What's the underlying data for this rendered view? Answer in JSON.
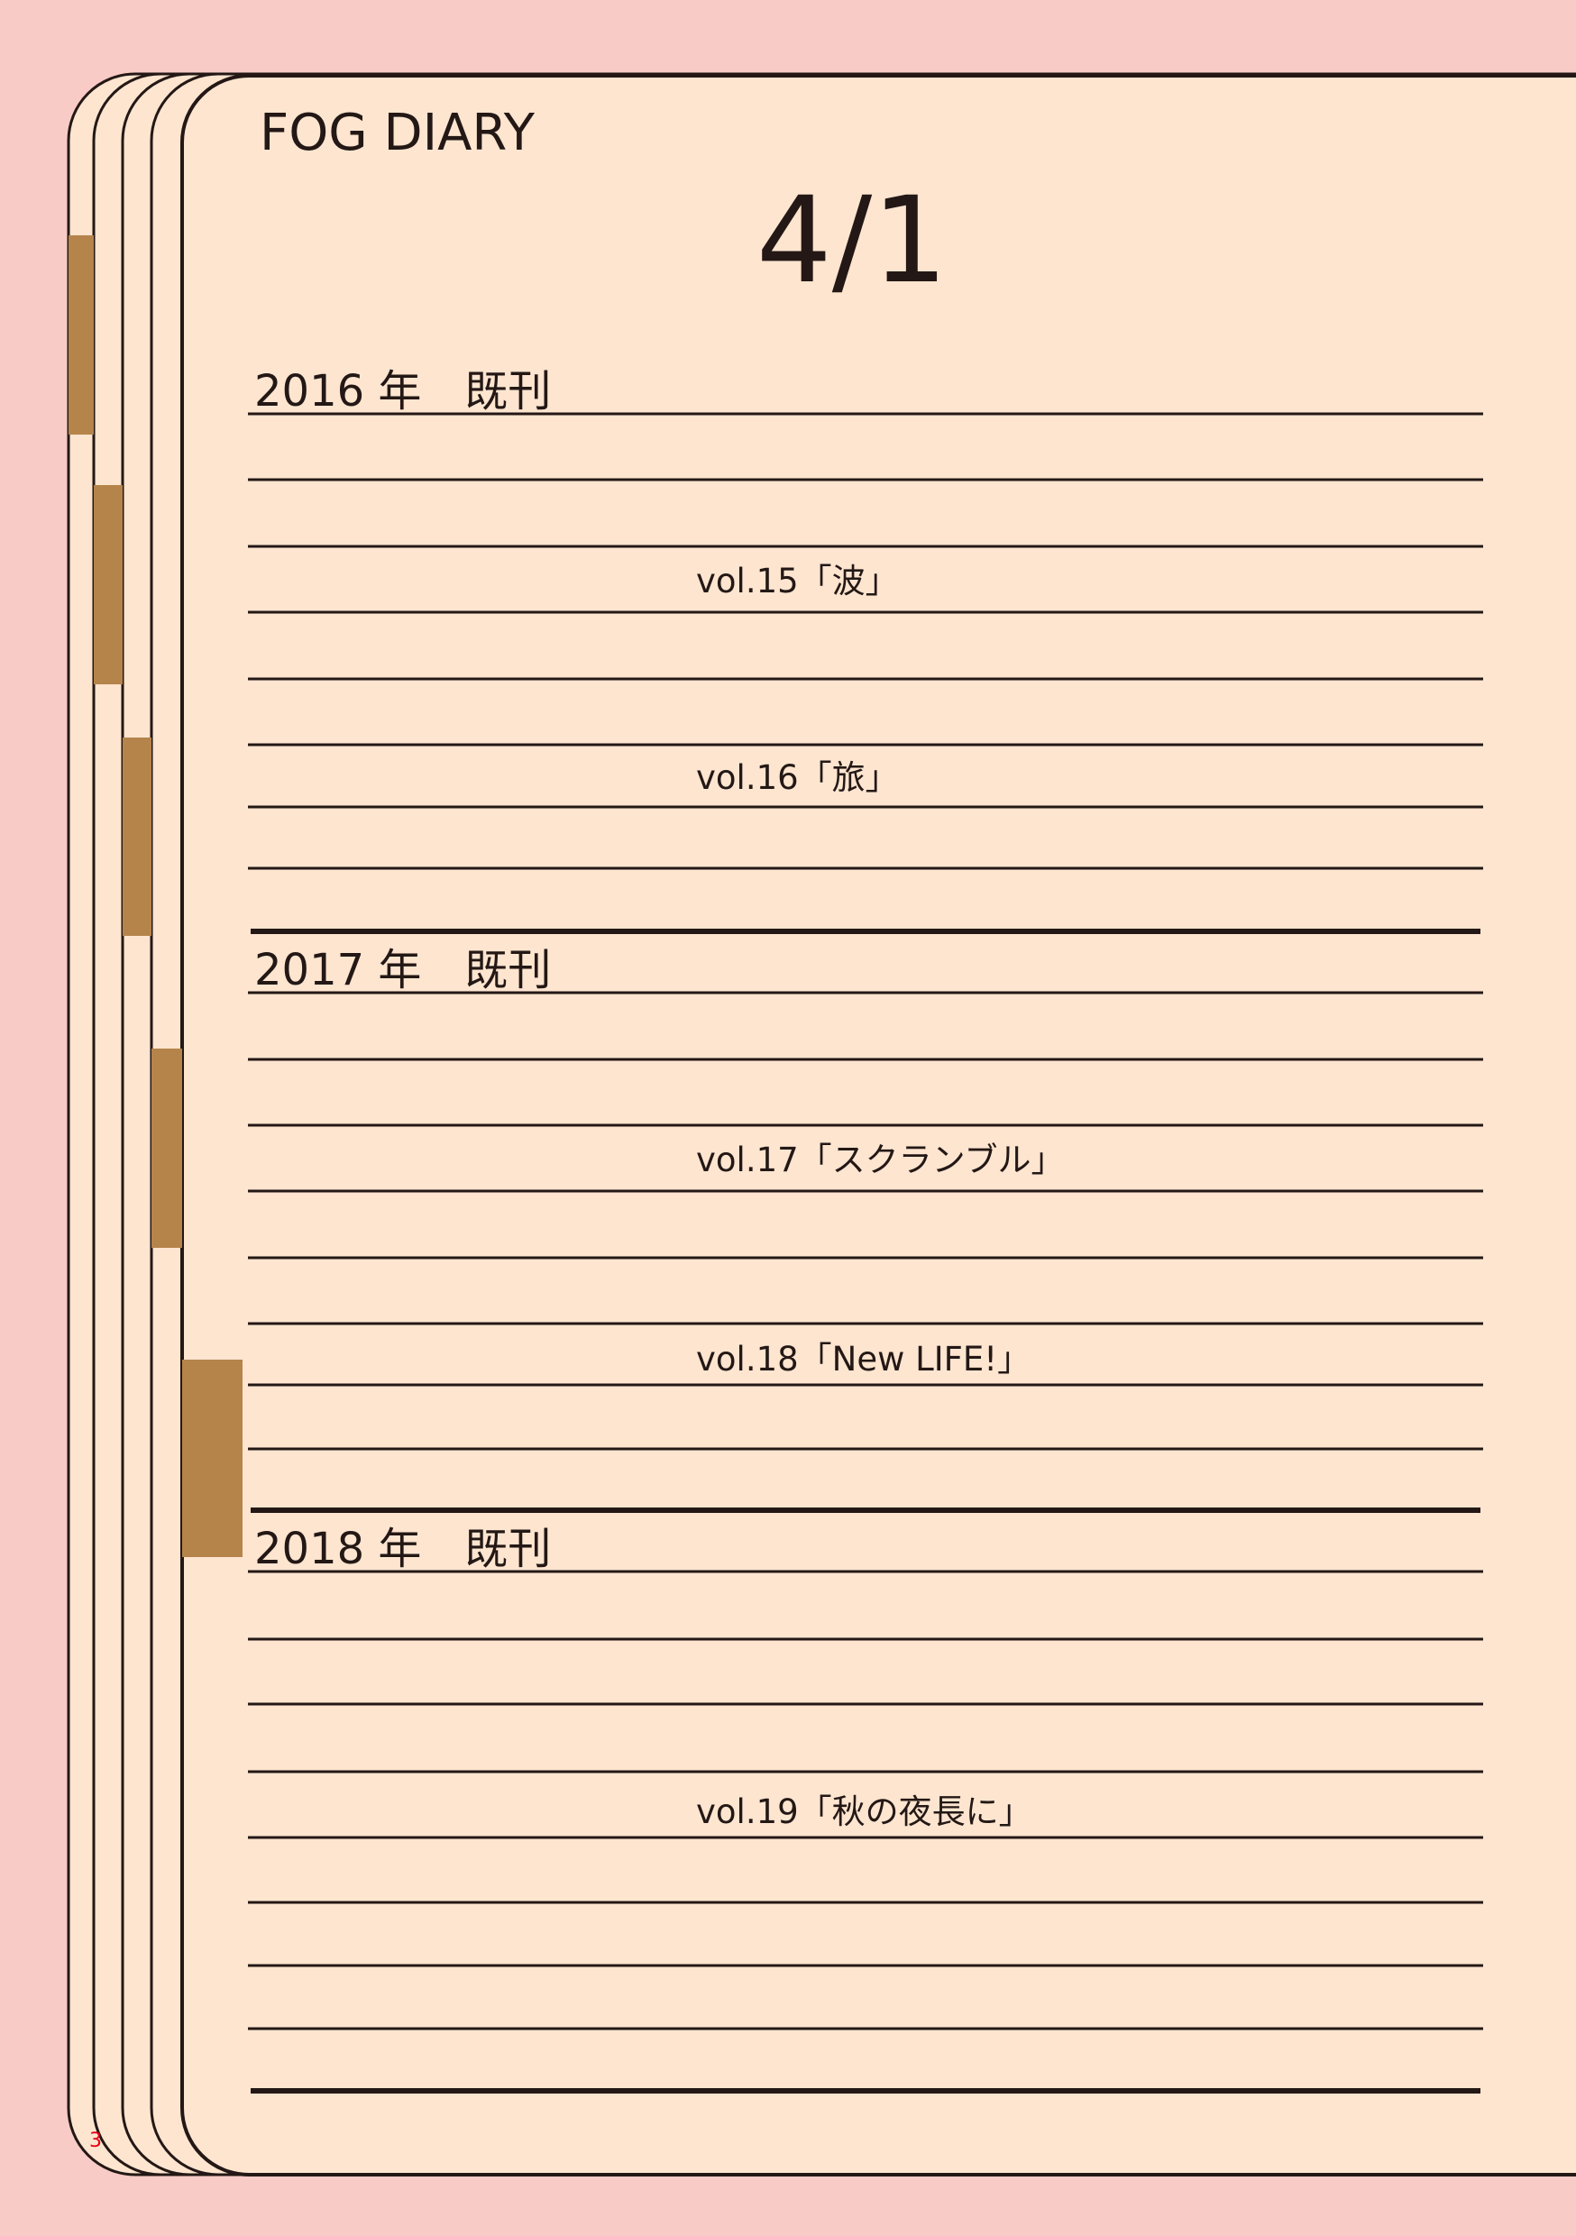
{
  "diary": {
    "title": "FOG DIARY",
    "date": "4/1",
    "page_number": "3"
  },
  "sections": [
    {
      "heading": "2016 年　既刊",
      "entries": [
        "vol.15「波」",
        "vol.16「旅」"
      ]
    },
    {
      "heading": "2017 年　既刊",
      "entries": [
        "vol.17「スクランブル」",
        "vol.18「New LIFE!」"
      ]
    },
    {
      "heading": "2018 年　既刊",
      "entries": [
        "vol.19「秋の夜長に」"
      ]
    }
  ],
  "colors": {
    "background": "#F8CBC6",
    "page": "#FDE5D0",
    "ink": "#231815",
    "tab": "#B5844B",
    "page_number": "#E60012"
  }
}
